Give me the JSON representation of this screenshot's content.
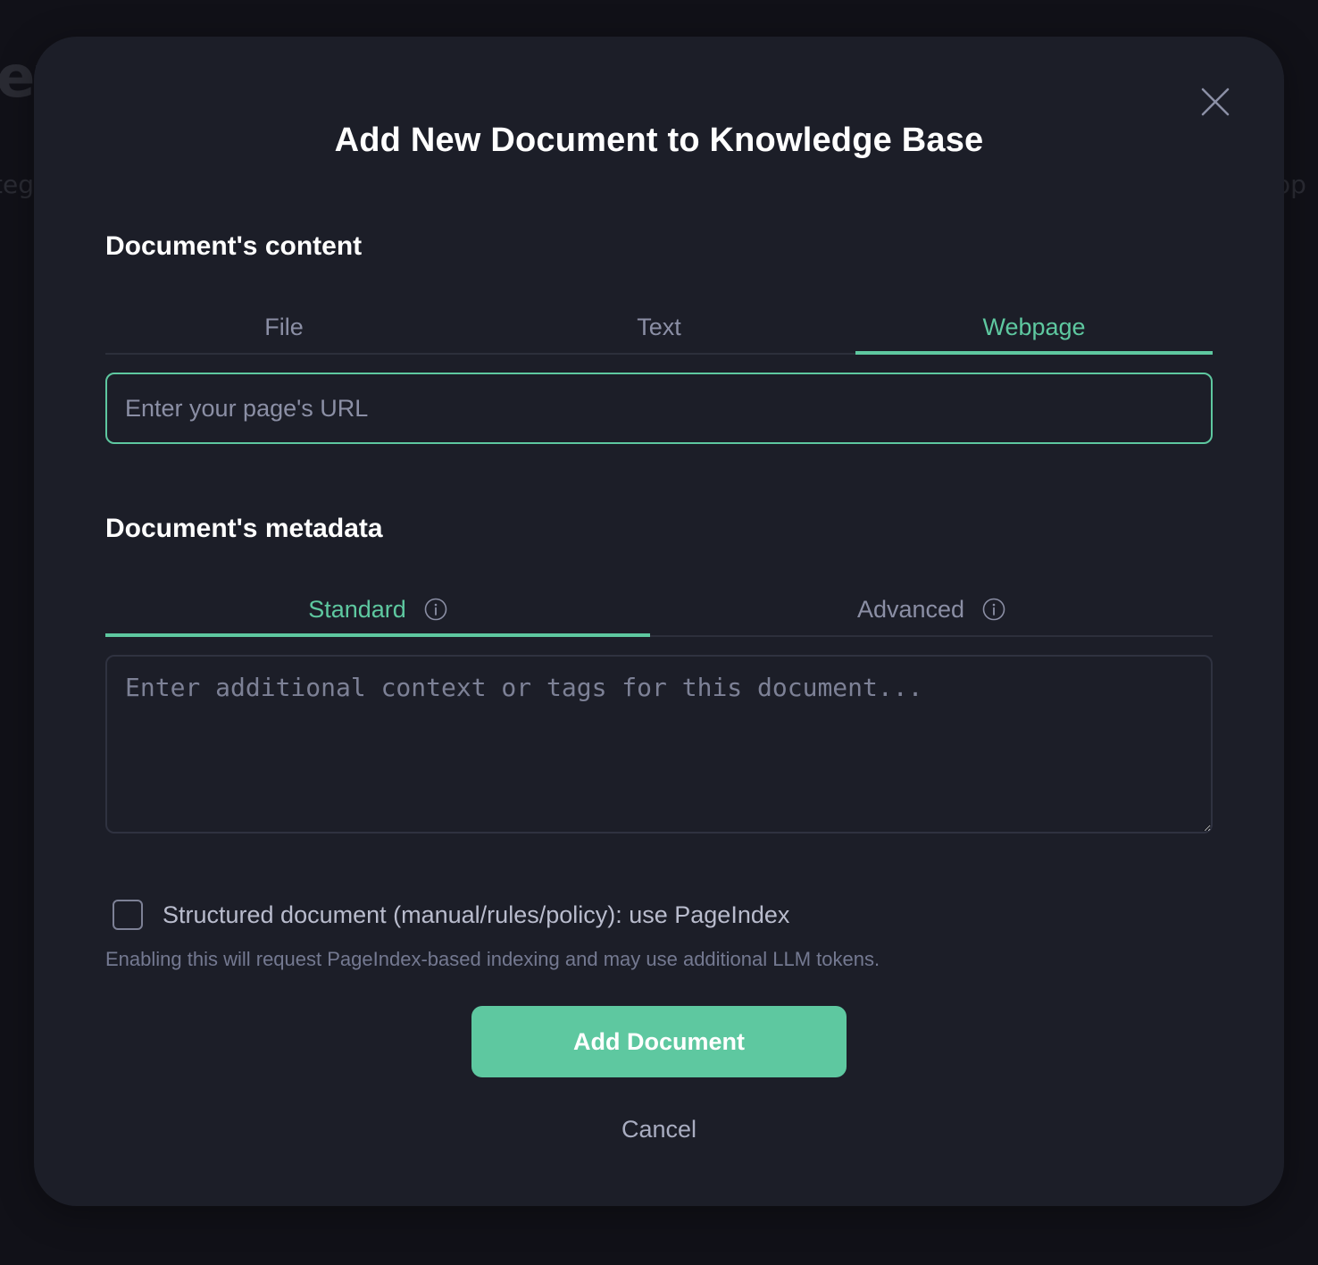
{
  "background": {
    "ghost_title": "et",
    "ghost_left": "teg",
    "ghost_right": "op"
  },
  "modal": {
    "title": "Add New Document to Knowledge Base",
    "close_icon": "close-icon",
    "content_section": {
      "heading": "Document's content",
      "tabs": [
        {
          "label": "File",
          "active": false
        },
        {
          "label": "Text",
          "active": false
        },
        {
          "label": "Webpage",
          "active": true
        }
      ],
      "url_input": {
        "placeholder": "Enter your page's URL",
        "value": ""
      }
    },
    "metadata_section": {
      "heading": "Document's metadata",
      "tabs": [
        {
          "label": "Standard",
          "active": true,
          "icon": "info-icon"
        },
        {
          "label": "Advanced",
          "active": false,
          "icon": "info-icon"
        }
      ],
      "textarea": {
        "placeholder": "Enter additional context or tags for this document...",
        "value": ""
      }
    },
    "structured_option": {
      "checked": false,
      "label": "Structured document (manual/rules/policy): use PageIndex",
      "hint": "Enabling this will request PageIndex-based indexing and may use additional LLM tokens."
    },
    "actions": {
      "primary_label": "Add Document",
      "cancel_label": "Cancel"
    }
  },
  "colors": {
    "accent": "#5ec8a0",
    "modal_bg": "#1c1e28",
    "page_bg": "#111118",
    "muted_text": "#8b8fa5"
  }
}
